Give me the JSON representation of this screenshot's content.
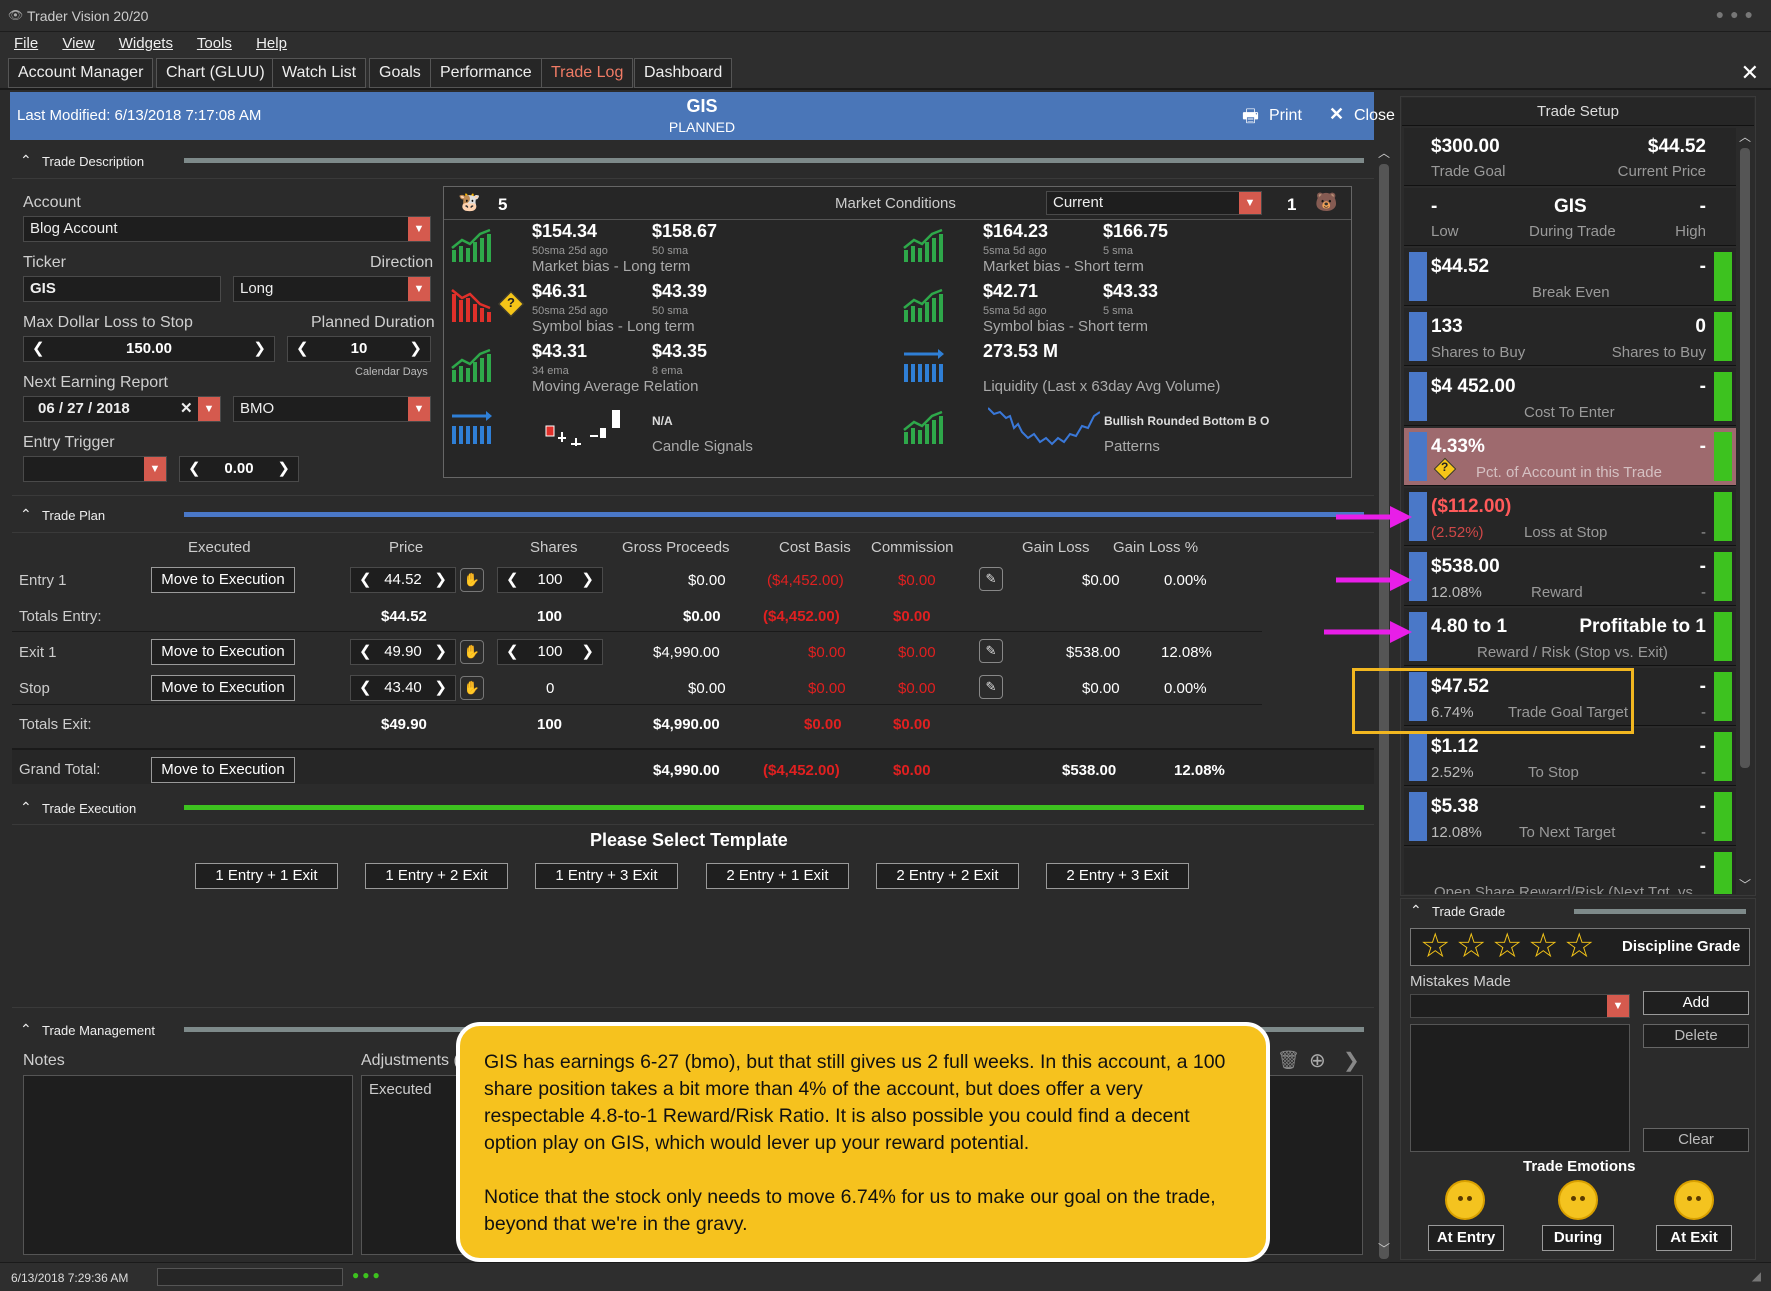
{
  "app": {
    "title": "Trader Vision 20/20"
  },
  "menu": [
    "File",
    "View",
    "Widgets",
    "Tools",
    "Help"
  ],
  "tabs": [
    "Account Manager",
    "Chart (GLUU)",
    "Watch List",
    "Goals",
    "Performance",
    "Trade Log",
    "Dashboard"
  ],
  "header": {
    "last_modified": "Last Modified: 6/13/2018 7:17:08 AM",
    "symbol": "GIS",
    "status": "PLANNED",
    "print": "Print",
    "close": "Close"
  },
  "trade_description": {
    "section_title": "Trade Description",
    "account_label": "Account",
    "account_value": "Blog Account",
    "ticker_label": "Ticker",
    "ticker_value": "GIS",
    "direction_label": "Direction",
    "direction_value": "Long",
    "max_loss_label": "Max Dollar Loss to Stop",
    "max_loss_value": "150.00",
    "duration_label": "Planned Duration",
    "duration_value": "10",
    "duration_unit": "Calendar Days",
    "earning_label": "Next Earning Report",
    "earning_value": "06 / 27 / 2018",
    "earning_timing": "BMO",
    "entry_trigger_label": "Entry Trigger",
    "entry_trigger_value": "0.00"
  },
  "market": {
    "bull_count": "5",
    "title": "Market Conditions",
    "selector": "Current",
    "bear_count": "1",
    "cells": [
      {
        "v1": "$154.34",
        "s1": "50sma 25d ago",
        "v2": "$158.67",
        "s2": "50 sma",
        "label": "Market bias - Long term"
      },
      {
        "v1": "$164.23",
        "s1": "5sma 5d ago",
        "v2": "$166.75",
        "s2": "5 sma",
        "label": "Market bias - Short term"
      },
      {
        "v1": "$46.31",
        "s1": "50sma 25d ago",
        "v2": "$43.39",
        "s2": "50 sma",
        "label": "Symbol bias - Long term"
      },
      {
        "v1": "$42.71",
        "s1": "5sma 5d ago",
        "v2": "$43.33",
        "s2": "5 sma",
        "label": "Symbol bias - Short term"
      },
      {
        "v1": "$43.31",
        "s1": "34 ema",
        "v2": "$43.35",
        "s2": "8 ema",
        "label": "Moving Average Relation"
      },
      {
        "v1": "273.53 M",
        "s1": "",
        "v2": "",
        "s2": "",
        "label": "Liquidity (Last x 63day Avg Volume)"
      }
    ],
    "candle_value": "N/A",
    "candle_label": "Candle Signals",
    "pattern_value": "Bullish Rounded Bottom B O",
    "pattern_label": "Patterns"
  },
  "trade_plan": {
    "section_title": "Trade Plan",
    "columns": [
      "Executed",
      "Price",
      "Shares",
      "Gross Proceeds",
      "Cost Basis",
      "Commission",
      "Gain Loss",
      "Gain Loss %"
    ],
    "move_label": "Move to Execution",
    "entry1": {
      "label": "Entry 1",
      "price": "44.52",
      "shares": "100",
      "gross": "$0.00",
      "cost": "($4,452.00)",
      "comm": "$0.00",
      "gain": "$0.00",
      "gainpct": "0.00%"
    },
    "totals_entry": {
      "label": "Totals Entry:",
      "price": "$44.52",
      "shares": "100",
      "gross": "$0.00",
      "cost": "($4,452.00)",
      "comm": "$0.00"
    },
    "exit1": {
      "label": "Exit 1",
      "price": "49.90",
      "shares": "100",
      "gross": "$4,990.00",
      "cost": "$0.00",
      "comm": "$0.00",
      "gain": "$538.00",
      "gainpct": "12.08%"
    },
    "stop": {
      "label": "Stop",
      "price": "43.40",
      "shares": "0",
      "gross": "$0.00",
      "cost": "$0.00",
      "comm": "$0.00",
      "gain": "$0.00",
      "gainpct": "0.00%"
    },
    "totals_exit": {
      "label": "Totals Exit:",
      "price": "$49.90",
      "shares": "100",
      "gross": "$4,990.00",
      "cost": "$0.00",
      "comm": "$0.00"
    },
    "grand": {
      "label": "Grand Total:",
      "gross": "$4,990.00",
      "cost": "($4,452.00)",
      "comm": "$0.00",
      "gain": "$538.00",
      "gainpct": "12.08%"
    }
  },
  "trade_execution": {
    "section_title": "Trade Execution",
    "prompt": "Please Select Template",
    "templates": [
      "1 Entry + 1 Exit",
      "1 Entry + 2 Exit",
      "1 Entry + 3 Exit",
      "2 Entry + 1 Exit",
      "2 Entry + 2 Exit",
      "2 Entry + 3 Exit"
    ]
  },
  "trade_management": {
    "section_title": "Trade Management",
    "notes": "Notes",
    "adjustments": "Adjustments (",
    "executed": "Executed"
  },
  "callout": {
    "p1": "GIS has earnings 6-27 (bmo), but that still gives us 2 full weeks.  In this account, a 100 share position takes a bit more than 4% of the account, but does offer a very respectable 4.8-to-1 Reward/Risk Ratio.  It is also possible you could find a decent option play on GIS, which would lever up your reward potential.",
    "p2": "Notice that the stock only needs to move 6.74% for us to make our goal on the trade, beyond that we're in the gravy."
  },
  "trade_setup": {
    "title": "Trade Setup",
    "goal_value": "$300.00",
    "goal_label": "Trade Goal",
    "price_value": "$44.52",
    "price_label": "Current Price",
    "low_value": "-",
    "low_label": "Low",
    "symbol": "GIS",
    "during_label": "During Trade",
    "high_value": "-",
    "high_label": "High",
    "cards": [
      {
        "val": "$44.52",
        "rv": "-",
        "sub": "Break Even",
        "pct": "",
        "sub2": ""
      },
      {
        "val": "133",
        "rv": "0",
        "sub": "Shares to Buy",
        "pct": "",
        "sub2": "Shares to Buy"
      },
      {
        "val": "$4 452.00",
        "rv": "-",
        "sub": "Cost To Enter",
        "pct": "",
        "sub2": ""
      },
      {
        "val": "4.33%",
        "rv": "-",
        "sub": "Pct. of Account in this Trade",
        "pct": "",
        "sub2": ""
      },
      {
        "val": "($112.00)",
        "rv": "",
        "sub": "Loss at Stop",
        "pct": "(2.52%)",
        "sub2": "-"
      },
      {
        "val": "$538.00",
        "rv": "-",
        "sub": "Reward",
        "pct": "12.08%",
        "sub2": "-"
      },
      {
        "val": "4.80 to 1",
        "rv": "Profitable to 1",
        "sub": "Reward / Risk (Stop vs. Exit)",
        "pct": "",
        "sub2": ""
      },
      {
        "val": "$47.52",
        "rv": "-",
        "sub": "Trade Goal Target",
        "pct": "6.74%",
        "sub2": "-"
      },
      {
        "val": "$1.12",
        "rv": "-",
        "sub": "To Stop",
        "pct": "2.52%",
        "sub2": "-"
      },
      {
        "val": "$5.38",
        "rv": "-",
        "sub": "To Next Target",
        "pct": "12.08%",
        "sub2": "-"
      },
      {
        "val": "",
        "rv": "-",
        "sub": "Open Share Reward/Risk (Next Tgt. vs.",
        "pct": "",
        "sub2": ""
      }
    ]
  },
  "trade_grade": {
    "title": "Trade Grade",
    "discipline": "Discipline Grade",
    "mistakes": "Mistakes Made",
    "add": "Add",
    "delete": "Delete",
    "clear": "Clear",
    "emotions": "Trade Emotions",
    "at_entry": "At Entry",
    "during": "During",
    "at_exit": "At Exit"
  },
  "statusbar": {
    "timestamp": "6/13/2018 7:29:36 AM"
  }
}
